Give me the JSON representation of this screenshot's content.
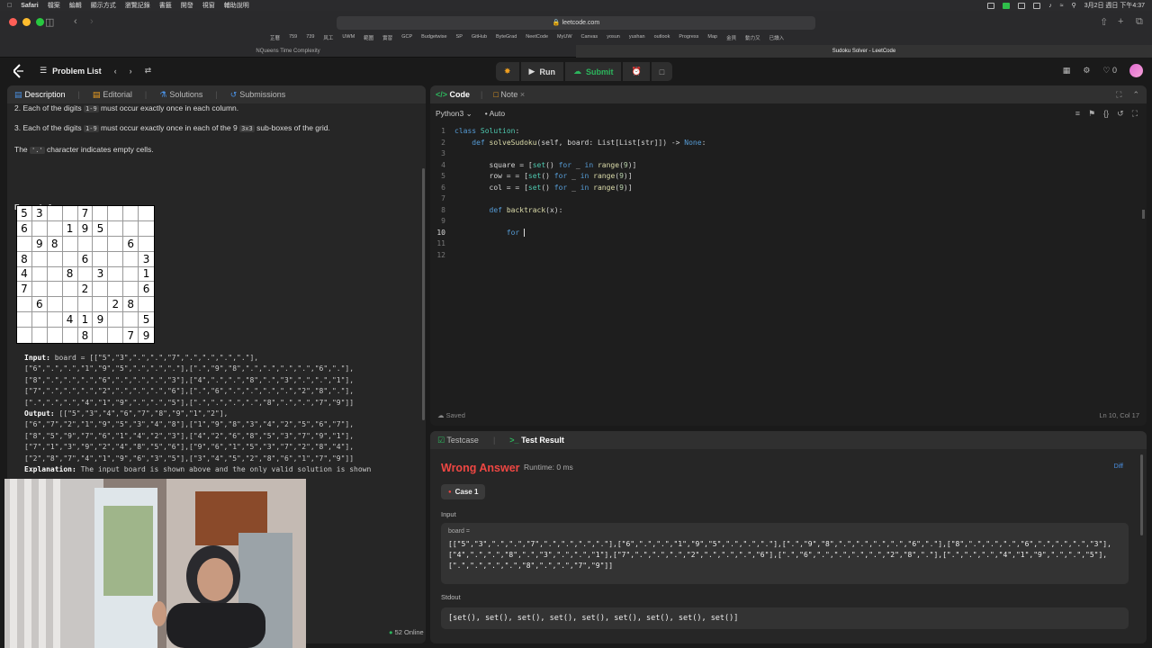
{
  "menubar": {
    "app": "Safari",
    "items": [
      "檔案",
      "編輯",
      "顯示方式",
      "瀏覽記錄",
      "書籤",
      "開發",
      "視窗",
      "輔助說明"
    ],
    "datetime": "3月2日 週日 下午4:37"
  },
  "safari": {
    "url": "leetcode.com",
    "bookmarks": [
      "芷曆",
      "759",
      "739",
      "风工",
      "UWM",
      "範圍",
      "實習",
      "GCP",
      "Budgetwise",
      "SP",
      "GitHub",
      "ByteGrad",
      "NeetCode",
      "MyUW",
      "Canvas",
      "yosun",
      "yushan",
      "outlook",
      "Progress",
      "Map",
      "金貝",
      "動力又",
      "已讀入"
    ],
    "tabs": [
      "NQueens Time Complexity",
      "Sudoku Solver - LeetCode"
    ]
  },
  "header": {
    "problem_list": "Problem List",
    "run": "Run",
    "submit": "Submit",
    "streak": "0"
  },
  "left": {
    "tabs": [
      "Description",
      "Editorial",
      "Solutions",
      "Submissions"
    ],
    "rules": [
      {
        "pre": "2.  Each of the digits ",
        "chip": "1-9",
        "post": " must occur exactly once in each column."
      },
      {
        "pre": "3.  Each of the digits ",
        "chip": "1-9",
        "post": " must occur exactly once in each of the 9 ",
        "chip2": "3x3",
        "post2": " sub-boxes of the grid."
      }
    ],
    "empty_pre": "The ",
    "empty_chip": "'.'",
    "empty_post": " character indicates empty cells.",
    "example_title": "Example 1:",
    "sudoku": [
      [
        "5",
        "3",
        "",
        "",
        "7",
        "",
        "",
        "",
        ""
      ],
      [
        "6",
        "",
        "",
        "1",
        "9",
        "5",
        "",
        "",
        ""
      ],
      [
        "",
        "9",
        "8",
        "",
        "",
        "",
        "",
        "6",
        ""
      ],
      [
        "8",
        "",
        "",
        "",
        "6",
        "",
        "",
        "",
        "3"
      ],
      [
        "4",
        "",
        "",
        "8",
        "",
        "3",
        "",
        "",
        "1"
      ],
      [
        "7",
        "",
        "",
        "",
        "2",
        "",
        "",
        "",
        "6"
      ],
      [
        "",
        "6",
        "",
        "",
        "",
        "",
        "2",
        "8",
        ""
      ],
      [
        "",
        "",
        "",
        "4",
        "1",
        "9",
        "",
        "",
        "5"
      ],
      [
        "",
        "",
        "",
        "",
        "8",
        "",
        "",
        "7",
        "9"
      ]
    ],
    "input_label": "Input:",
    "input_lines": [
      " board = [[\"5\",\"3\",\".\",\".\",\"7\",\".\",\".\",\".\",\".\"],",
      "[\"6\",\".\",\".\",\"1\",\"9\",\"5\",\".\",\".\",\".\"],[\".\",\"9\",\"8\",\".\",\".\",\".\",\".\",\"6\",\".\"],",
      "[\"8\",\".\",\".\",\".\",\"6\",\".\",\".\",\".\",\"3\"],[\"4\",\".\",\".\",\"8\",\".\",\"3\",\".\",\".\",\"1\"],",
      "[\"7\",\".\",\".\",\".\",\"2\",\".\",\".\",\".\",\"6\"],[\".\",\"6\",\".\",\".\",\".\",\".\",\"2\",\"8\",\".\"],",
      "[\".\",\".\",\".\",\"4\",\"1\",\"9\",\".\",\".\",\"5\"],[\".\",\".\",\".\",\".\",\"8\",\".\",\".\",\"7\",\"9\"]]"
    ],
    "output_label": "Output:",
    "output_lines": [
      " [[\"5\",\"3\",\"4\",\"6\",\"7\",\"8\",\"9\",\"1\",\"2\"],",
      "[\"6\",\"7\",\"2\",\"1\",\"9\",\"5\",\"3\",\"4\",\"8\"],[\"1\",\"9\",\"8\",\"3\",\"4\",\"2\",\"5\",\"6\",\"7\"],",
      "[\"8\",\"5\",\"9\",\"7\",\"6\",\"1\",\"4\",\"2\",\"3\"],[\"4\",\"2\",\"6\",\"8\",\"5\",\"3\",\"7\",\"9\",\"1\"],",
      "[\"7\",\"1\",\"3\",\"9\",\"2\",\"4\",\"8\",\"5\",\"6\"],[\"9\",\"6\",\"1\",\"5\",\"3\",\"7\",\"2\",\"8\",\"4\"],",
      "[\"2\",\"8\",\"7\",\"4\",\"1\",\"9\",\"6\",\"3\",\"5\"],[\"3\",\"4\",\"5\",\"2\",\"8\",\"6\",\"1\",\"7\",\"9\"]]"
    ],
    "explanation_label": "Explanation:",
    "explanation": " The input board is shown above and the only valid solution is shown",
    "online": "52 Online"
  },
  "code": {
    "tabs": [
      "Code",
      "Note"
    ],
    "language": "Python3",
    "mode": "Auto",
    "saved": "Saved",
    "position": "Ln 10, Col 17"
  },
  "test": {
    "tabs": [
      "Testcase",
      "Test Result"
    ],
    "verdict": "Wrong Answer",
    "runtime": "Runtime: 0 ms",
    "diff": "Diff",
    "case": "Case 1",
    "input_label": "Input",
    "input_name": "board =",
    "input_value": "[[\"5\",\"3\",\".\",\".\",\"7\",\".\",\".\",\".\",\".\"],[\"6\",\".\",\".\",\"1\",\"9\",\"5\",\".\",\".\",\".\"],[\".\",\"9\",\"8\",\".\",\".\",\".\",\".\",\"6\",\".\"],[\"8\",\".\",\".\",\".\",\"6\",\".\",\".\",\".\",\"3\"],[\"4\",\".\",\".\",\"8\",\".\",\"3\",\".\",\".\",\"1\"],[\"7\",\".\",\".\",\".\",\"2\",\".\",\".\",\".\",\"6\"],[\".\",\"6\",\".\",\".\",\".\",\".\",\"2\",\"8\",\".\"],[\".\",\".\",\".\",\"4\",\"1\",\"9\",\".\",\".\",\"5\"],[\".\",\".\",\".\",\".\",\"8\",\".\",\".\",\"7\",\"9\"]]",
    "stdout_label": "Stdout",
    "stdout": "[set(), set(), set(), set(), set(), set(), set(), set(), set()]"
  },
  "colors": {
    "accent_green": "#2db55d",
    "wrong_red": "#ef4743",
    "run_orange": "#f0a020"
  }
}
